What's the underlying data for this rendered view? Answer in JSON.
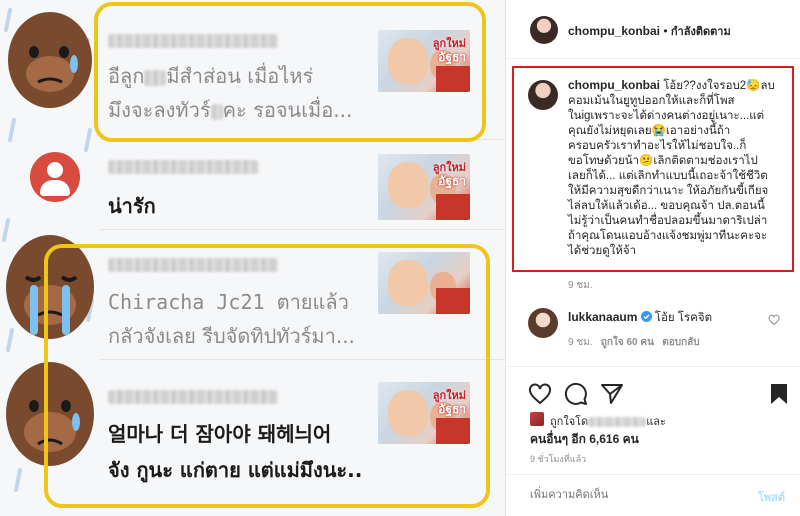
{
  "left_panel": {
    "comments": [
      {
        "text_line1": "อีลูก",
        "text_line1b": "มีสำส่อน เมื่อไหร่",
        "text_line2": "มึงจะลงทัวร์",
        "text_line2b": "คะ รอจนเมื่อ..."
      },
      {
        "text": "น่ารัก"
      },
      {
        "text_line1": "Chiracha Jc21 ตายแล้ว",
        "text_line2": "กลัวจังเลย รีบจัดทิปทัวร์มา..."
      },
      {
        "text_line1": "얼마나 더 잠아야 돼헤늬어",
        "text_line2": "จัง กูนะ แก่ตาย แต่แม่มึงนะ.."
      }
    ],
    "thumbnail_title": "ลูกใหม่",
    "thumbnail_subtitle": "อัฐธา"
  },
  "post_header": {
    "username": "chompu_konbai",
    "separator": " • ",
    "follow_label": "กำลังติดตาม"
  },
  "main_comment": {
    "username": "chompu_konbai",
    "lines": [
      "โอ้ย??งงใจรอบ2😓ลบ",
      "คอมเม้นในยูทูปออกให้และก็ที่โพส",
      "ในigเพราะจะได้ด่างคนต่างอยู่เนาะ...แต่",
      "คุณยังไม่หยุดเลย😭เอาอย่างนี้ถ้า",
      "ครอบครัวเราทำอะไรให้ไม่ชอบใจ..ก็",
      "ขอโทษด้วยน้า😕เลิกติดตามช่องเราไป",
      "เลยก็ได้... แต่เลิกทำแบบนี้เถอะจ้าใช้ชีวิต",
      "ให้มีความสุขดีกว่าเนาะ ให้อภัยกันขี้เกียจ",
      "ไล่ลบให้แล้วเด้อ... ขอบคุณจ้า ปล.ตอนนี้",
      "ไม่รู้ว่าเป็นคนทำชื่อปลอมขึ้นมาดาริเปล่า",
      "ถ้าคุณโดนแอบอ้างแจ้งชมพู่มาทีนะคะจะ",
      "ได้ช่วยดูให้จ้า"
    ],
    "time": "9 ชม."
  },
  "reply_comment": {
    "username": "lukkanaaum",
    "text": "โอ้ย โรคจิต",
    "time": "9 ชม.",
    "likes": "ถูกใจ 60 คน",
    "reply_label": "ตอบกลับ"
  },
  "actions": {
    "liked_by_prefix": "ถูกใจโด",
    "liked_by_suffix": "และ",
    "others_label": "คนอื่นๆ อีก 6,616 คน",
    "posted_time": "9 ชั่วโมงที่แล้ว"
  },
  "comment_input": {
    "placeholder": "เพิ่มความคิดเห็น",
    "post_label": "โพสต์"
  },
  "colors": {
    "highlight_yellow": "#f0c419",
    "red_box": "#d21f1f",
    "verified_blue": "#3897f0",
    "post_link_blue": "#b2dffc"
  }
}
